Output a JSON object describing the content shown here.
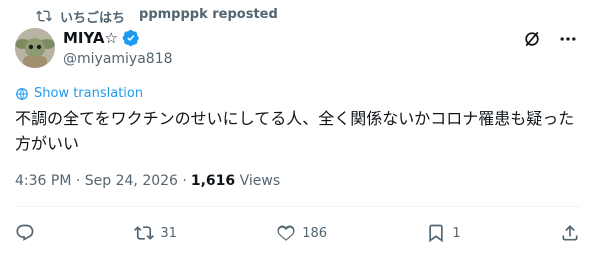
{
  "repost": {
    "icon": "repost-icon",
    "user": "いちごはち",
    "reposted_by": "ppmpppk reposted"
  },
  "author": {
    "name": "MIYA☆",
    "handle": "@miyamiya818",
    "verified_color": "#1d9bf0"
  },
  "top_icons": [
    "grok-icon",
    "more-icon"
  ],
  "translation": {
    "label": "Show translation"
  },
  "tweet": {
    "text": "不調の全てをワクチンのせいにしてる人、全く関係ないかコロナ罹患も疑った方がいい"
  },
  "meta": {
    "timestamp": "4:36 PM · Sep 24, 2026 · ",
    "views": "1,616",
    "views_label": " Views"
  },
  "actions": {
    "reply": {
      "icon": "reply-icon",
      "count": ""
    },
    "repost": {
      "icon": "repost-icon",
      "count": "31"
    },
    "like": {
      "icon": "heart-icon",
      "count": "186"
    },
    "bookmark": {
      "icon": "bookmark-icon",
      "count": "1"
    },
    "share": {
      "icon": "share-icon"
    }
  },
  "colors": {
    "accent": "#1d9bf0",
    "secondary_text": "#536471",
    "primary_text": "#0f1419"
  }
}
